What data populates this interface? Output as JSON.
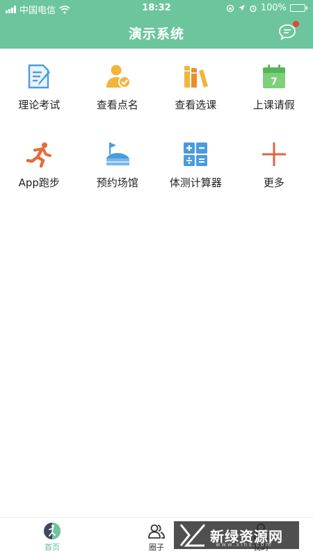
{
  "status_bar": {
    "carrier": "中国电信",
    "time": "18:32",
    "battery": "100%"
  },
  "header": {
    "title": "演示系统"
  },
  "menu": [
    {
      "label": "理论考试",
      "icon": "exam-doc-icon"
    },
    {
      "label": "查看点名",
      "icon": "roll-call-icon"
    },
    {
      "label": "查看选课",
      "icon": "books-icon"
    },
    {
      "label": "上课请假",
      "icon": "calendar-icon"
    },
    {
      "label": "App跑步",
      "icon": "running-icon"
    },
    {
      "label": "预约场馆",
      "icon": "stadium-icon"
    },
    {
      "label": "体测计算器",
      "icon": "calculator-icon"
    },
    {
      "label": "更多",
      "icon": "plus-icon"
    }
  ],
  "tabbar": [
    {
      "label": "首页",
      "active": true
    },
    {
      "label": "圈子",
      "active": false
    },
    {
      "label": "我的",
      "active": false
    }
  ],
  "watermark": {
    "text": "新绿资源网",
    "url": "www.xlhs.com"
  },
  "colors": {
    "brand": "#6cc59d",
    "badge": "#e8433a",
    "active_tab": "#5bbf8f"
  }
}
